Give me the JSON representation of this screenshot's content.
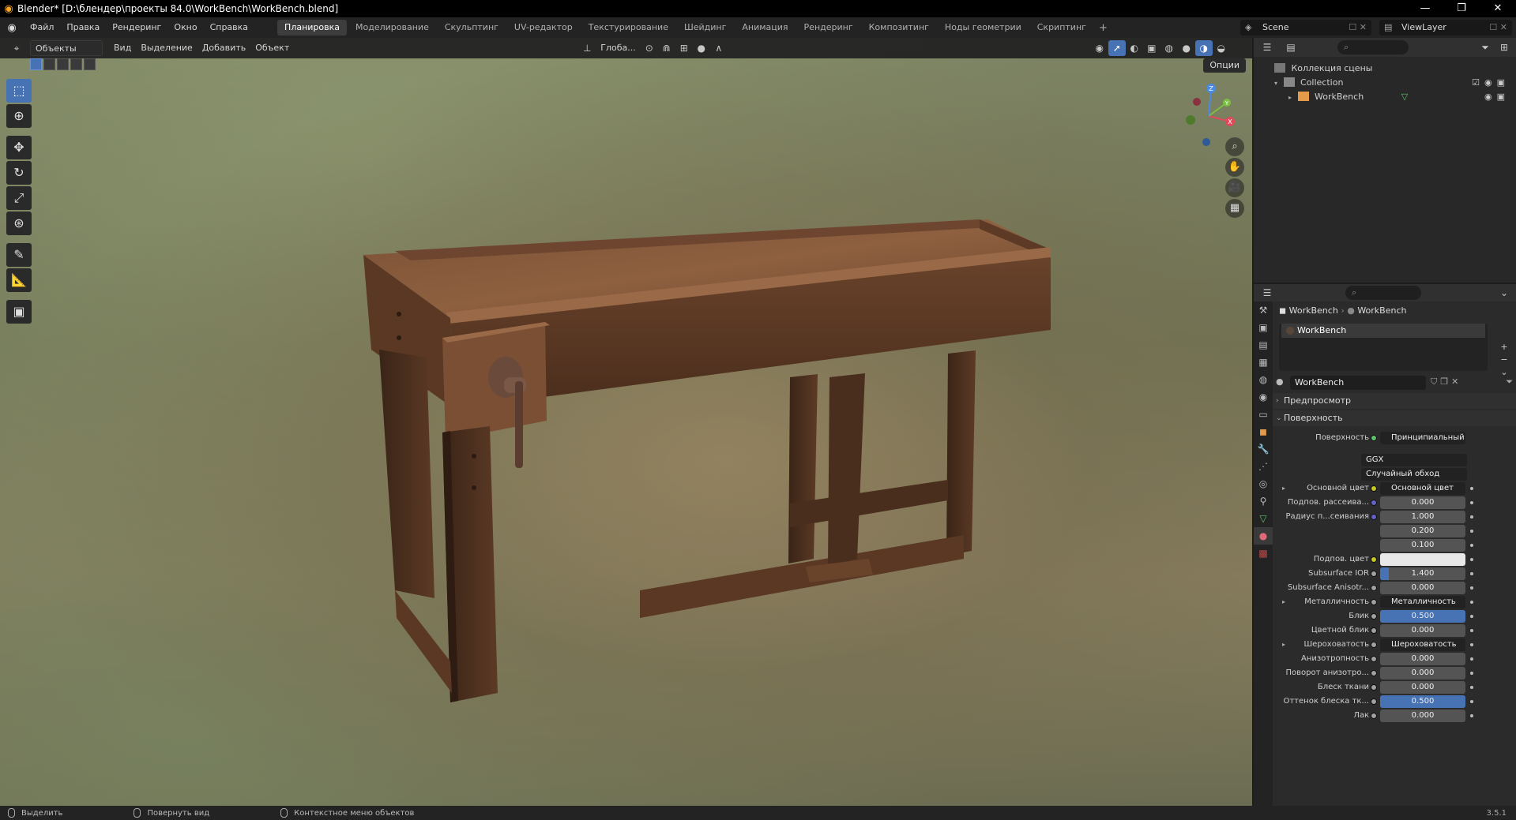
{
  "window": {
    "title": "Blender* [D:\\блендер\\проекты 84.0\\WorkBench\\WorkBench.blend]",
    "minimize": "—",
    "maximize": "❐",
    "close": "✕"
  },
  "menu": {
    "items": [
      "Файл",
      "Правка",
      "Рендеринг",
      "Окно",
      "Справка"
    ],
    "workspaces": [
      "Планировка",
      "Моделирование",
      "Скульптинг",
      "UV-редактор",
      "Текстурирование",
      "Шейдинг",
      "Анимация",
      "Рендеринг",
      "Композитинг",
      "Ноды геометрии",
      "Скриптинг"
    ],
    "active_workspace_index": 0,
    "add_tab": "+",
    "scene_label": "Scene",
    "view_layer_label": "ViewLayer"
  },
  "viewport": {
    "mode": "Объекты",
    "menus": [
      "Вид",
      "Выделение",
      "Добавить",
      "Объект"
    ],
    "transform_orientation": "Глоба...",
    "options": "Опции",
    "gizmo_axes": {
      "x": "X",
      "y": "Y",
      "z": "Z"
    }
  },
  "outliner": {
    "scene_collection": "Коллекция сцены",
    "collection": "Collection",
    "object": "WorkBench"
  },
  "properties": {
    "breadcrumb_object": "WorkBench",
    "breadcrumb_material": "WorkBench",
    "slot_name": "WorkBench",
    "material_name": "WorkBench",
    "panels": {
      "preview": "Предпросмотр",
      "surface": "Поверхность"
    },
    "surface_label": "Поверхность",
    "surface_shader": "Принципиальный BSDF",
    "distribution": "GGX",
    "subsurface_method": "Случайный обход",
    "rows": [
      {
        "label": "Основной цвет",
        "value": "Основной цвет",
        "kind": "link",
        "arrow": true,
        "sock": "#c7c729"
      },
      {
        "label": "Подпов. рассеива...",
        "value": "0.000",
        "kind": "num",
        "sock": "#6363c7",
        "fill": 0
      },
      {
        "label": "Радиус п...сеивания",
        "value": "1.000",
        "kind": "num",
        "sock": "#6363c7",
        "fill": 0
      },
      {
        "label": "",
        "value": "0.200",
        "kind": "num",
        "sock": "",
        "fill": 0
      },
      {
        "label": "",
        "value": "0.100",
        "kind": "num",
        "sock": "",
        "fill": 0
      },
      {
        "label": "Подпов. цвет",
        "value": "",
        "kind": "color",
        "sock": "#c7c729",
        "color": "#e8e8e8"
      },
      {
        "label": "Subsurface IOR",
        "value": "1.400",
        "kind": "num",
        "sock": "#a1a1a1",
        "fill": 0.1
      },
      {
        "label": "Subsurface Anisotr...",
        "value": "0.000",
        "kind": "num",
        "sock": "#a1a1a1",
        "fill": 0
      },
      {
        "label": "Металличность",
        "value": "Металличность",
        "kind": "link",
        "arrow": true,
        "sock": "#a1a1a1"
      },
      {
        "label": "Блик",
        "value": "0.500",
        "kind": "num",
        "sock": "#a1a1a1",
        "fill": 1.0
      },
      {
        "label": "Цветной блик",
        "value": "0.000",
        "kind": "num",
        "sock": "#a1a1a1",
        "fill": 0
      },
      {
        "label": "Шероховатость",
        "value": "Шероховатость",
        "kind": "link",
        "arrow": true,
        "sock": "#a1a1a1"
      },
      {
        "label": "Анизотропность",
        "value": "0.000",
        "kind": "num",
        "sock": "#a1a1a1",
        "fill": 0
      },
      {
        "label": "Поворот анизотро...",
        "value": "0.000",
        "kind": "num",
        "sock": "#a1a1a1",
        "fill": 0
      },
      {
        "label": "Блеск ткани",
        "value": "0.000",
        "kind": "num",
        "sock": "#a1a1a1",
        "fill": 0
      },
      {
        "label": "Оттенок блеска тк...",
        "value": "0.500",
        "kind": "num",
        "sock": "#a1a1a1",
        "fill": 1.0
      },
      {
        "label": "Лак",
        "value": "0.000",
        "kind": "num",
        "sock": "#a1a1a1",
        "fill": 0
      }
    ]
  },
  "status": {
    "select": "Выделить",
    "rotate": "Повернуть вид",
    "context": "Контекстное меню объектов",
    "version": "3.5.1"
  },
  "colors": {
    "accent": "#4772b3",
    "wood_dark": "#3a2417",
    "wood_mid": "#6a432b",
    "wood_light": "#8a5a3b"
  }
}
